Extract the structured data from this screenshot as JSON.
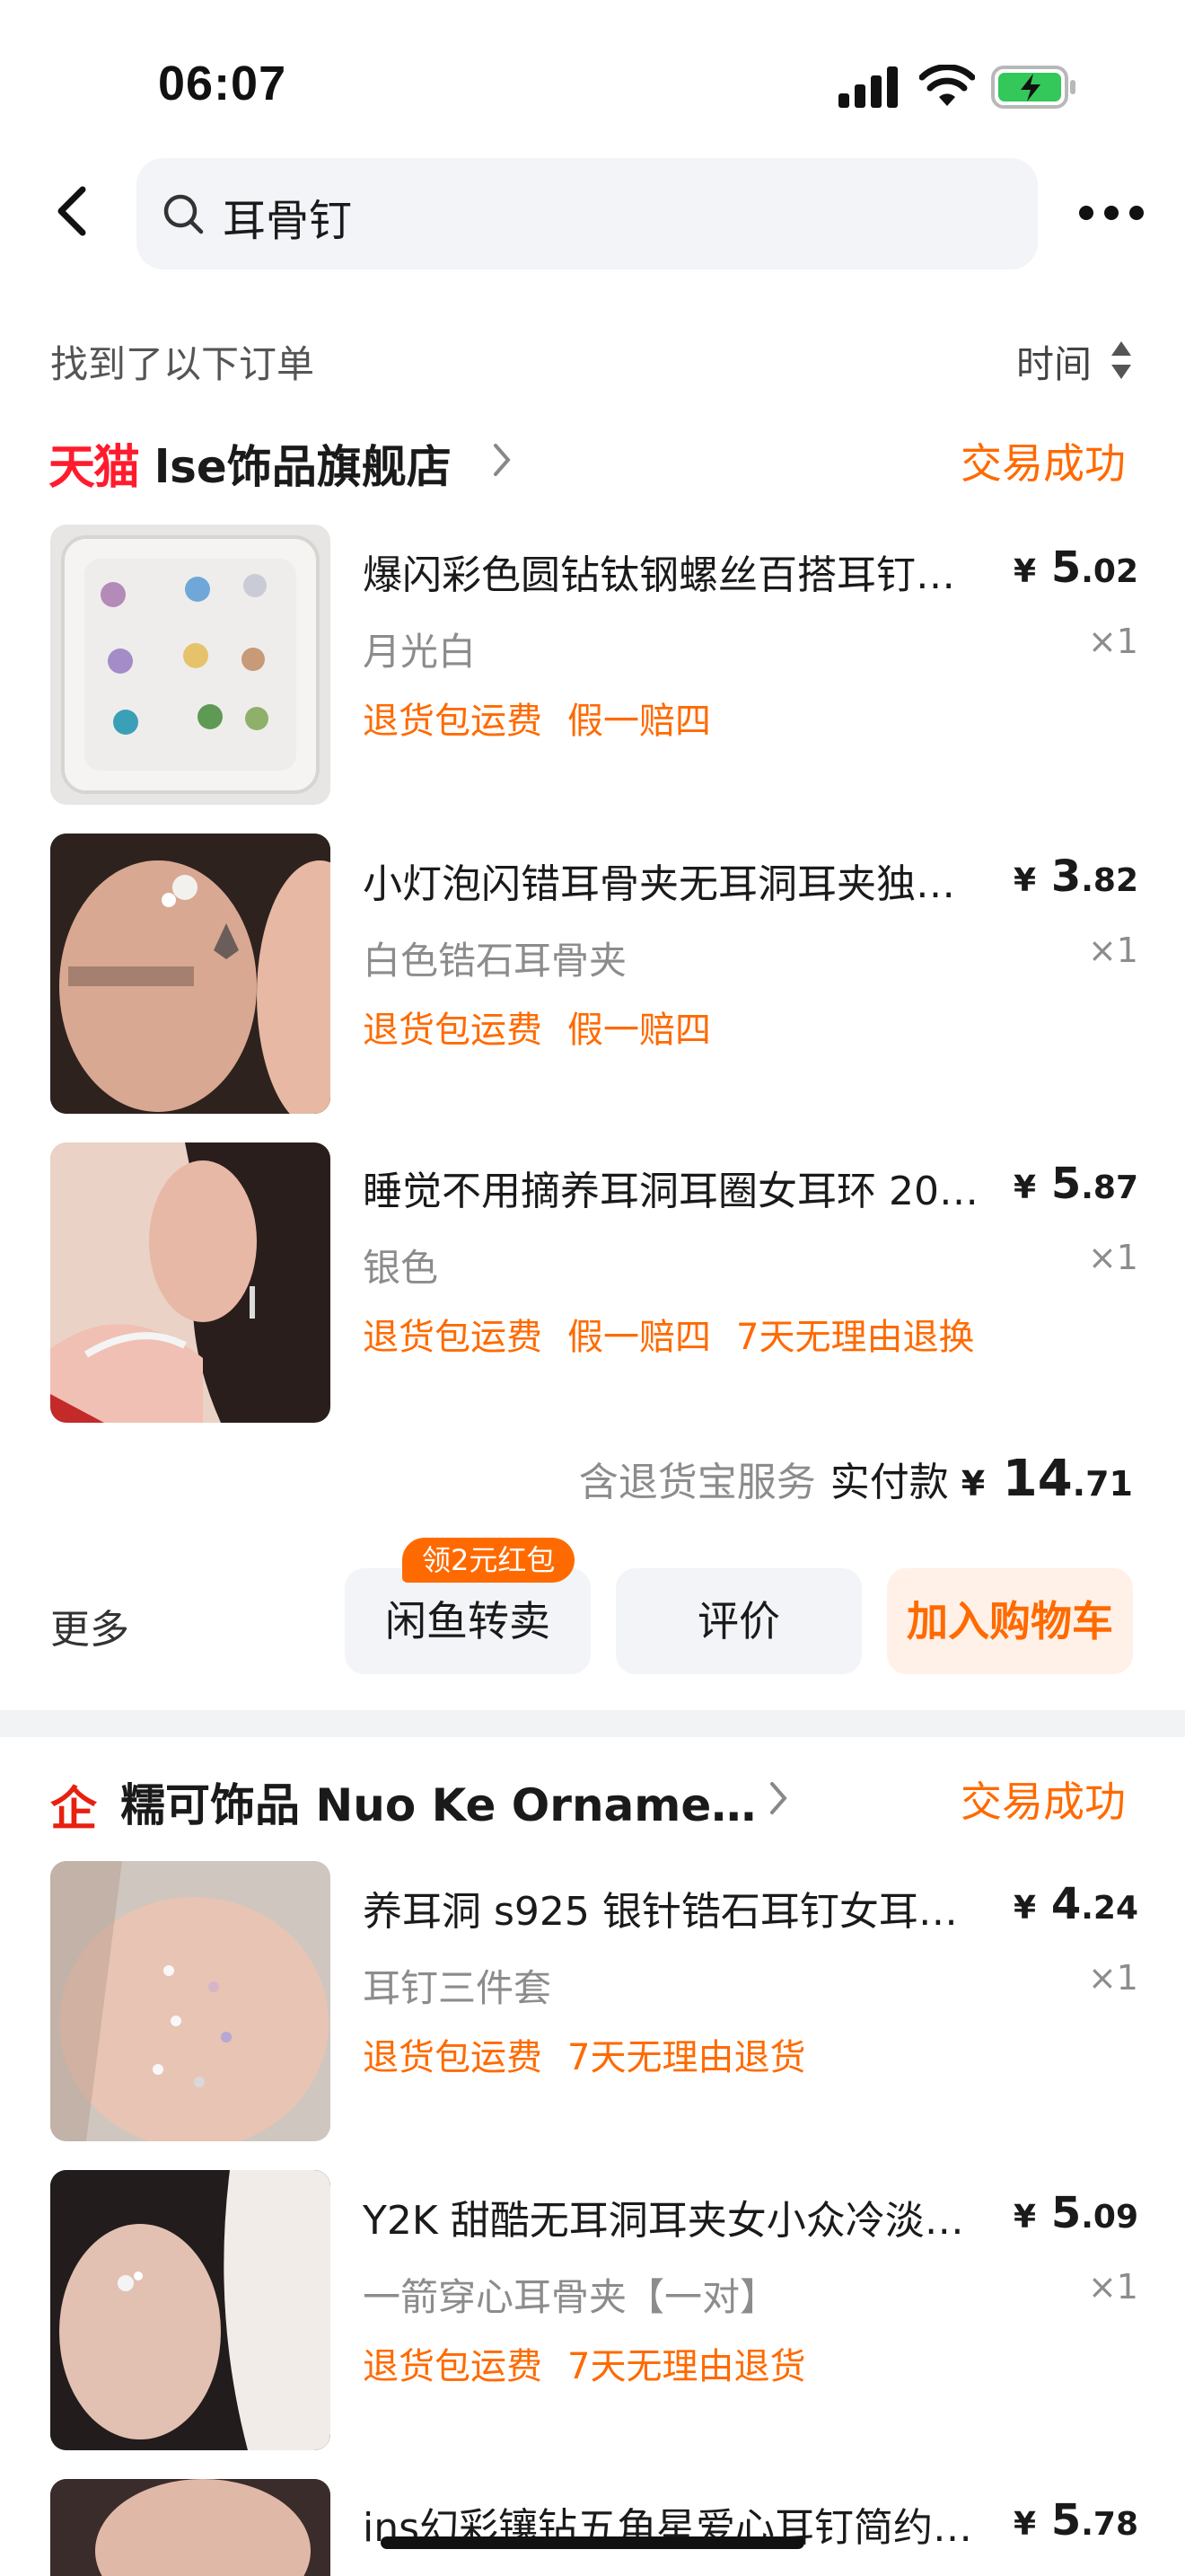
{
  "status_bar": {
    "time": "06:07"
  },
  "header": {
    "search_value": "耳骨钉"
  },
  "list_header": {
    "found_text": "找到了以下订单",
    "sort_label": "时间"
  },
  "orders": [
    {
      "store_badge": "天猫",
      "store_name": "lse饰品旗舰店",
      "status": "交易成功",
      "items": [
        {
          "title": "爆闪彩色圆钻钛钢螺丝百搭耳钉…",
          "variant": "月光白",
          "tags": [
            "退货包运费",
            "假一赔四"
          ],
          "price_currency": "¥",
          "price_int": "5",
          "price_dec": ".02",
          "qty": "×1"
        },
        {
          "title": "小灯泡闪错耳骨夹无耳洞耳夹独…",
          "variant": "白色锆石耳骨夹",
          "tags": [
            "退货包运费",
            "假一赔四"
          ],
          "price_currency": "¥",
          "price_int": "3",
          "price_dec": ".82",
          "qty": "×1"
        },
        {
          "title": "睡觉不用摘养耳洞耳圈女耳环 20…",
          "variant": "银色",
          "tags": [
            "退货包运费",
            "假一赔四",
            "7天无理由退换"
          ],
          "price_currency": "¥",
          "price_int": "5",
          "price_dec": ".87",
          "qty": "×1"
        }
      ],
      "summary": {
        "service": "含退货宝服务",
        "paid_label": "实付款",
        "currency": "¥",
        "amount_int": "14",
        "amount_dec": ".71"
      },
      "actions": {
        "more": "更多",
        "badge": "领2元红包",
        "resell": "闲鱼转卖",
        "review": "评价",
        "add_cart": "加入购物车"
      }
    },
    {
      "store_badge": "企",
      "store_name": "糯可饰品 Nuo Ke Orname…",
      "status": "交易成功",
      "items": [
        {
          "title": "养耳洞 s925 银针锆石耳钉女耳环…",
          "variant": "耳钉三件套",
          "tags": [
            "退货包运费",
            "7天无理由退货"
          ],
          "price_currency": "¥",
          "price_int": "4",
          "price_dec": ".24",
          "qty": "×1"
        },
        {
          "title": "Y2K 甜酷无耳洞耳夹女小众冷淡…",
          "variant": "一箭穿心耳骨夹【一对】",
          "tags": [
            "退货包运费",
            "7天无理由退货"
          ],
          "price_currency": "¥",
          "price_int": "5",
          "price_dec": ".09",
          "qty": "×1"
        },
        {
          "title": "ins幻彩镶钻五角星爱心耳钉简约…",
          "price_currency": "¥",
          "price_int": "5",
          "price_dec": ".78"
        }
      ]
    }
  ],
  "colors": {
    "accent": "#ff6a00",
    "tmall_red": "#ff1b2d",
    "qi_red": "#e8200f"
  }
}
